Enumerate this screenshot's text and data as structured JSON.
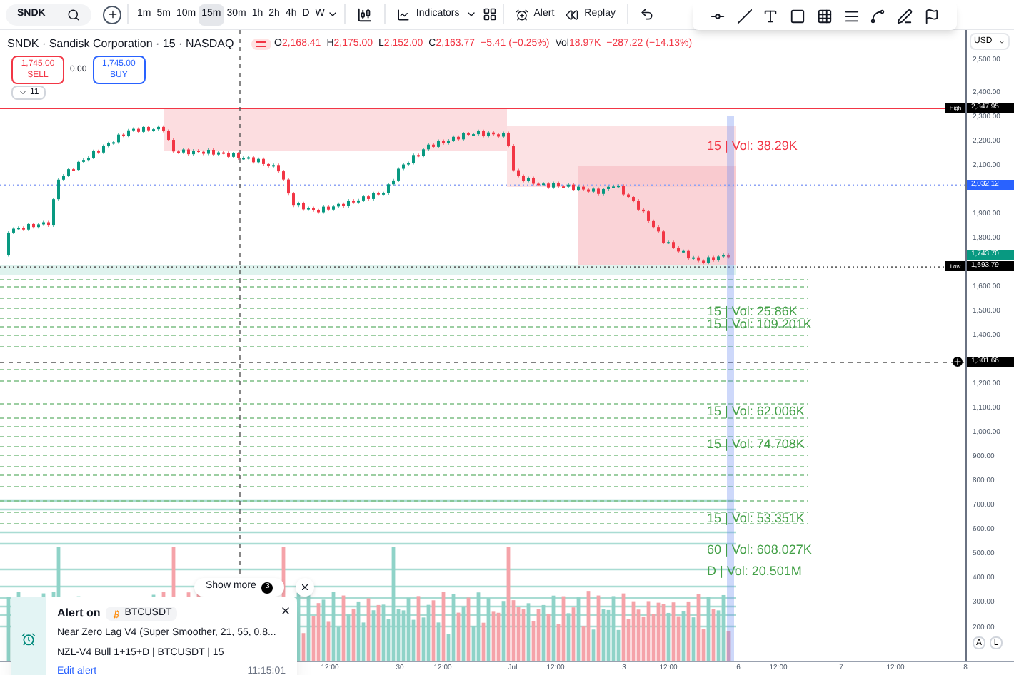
{
  "toolbar": {
    "symbol": "SNDK",
    "intervals": [
      {
        "label": "1m",
        "selected": false
      },
      {
        "label": "5m",
        "selected": false
      },
      {
        "label": "10m",
        "selected": false
      },
      {
        "label": "15m",
        "selected": true
      },
      {
        "label": "30m",
        "selected": false
      },
      {
        "label": "1h",
        "selected": false
      },
      {
        "label": "2h",
        "selected": false
      },
      {
        "label": "4h",
        "selected": false
      },
      {
        "label": "D",
        "selected": false
      },
      {
        "label": "W",
        "selected": false
      }
    ],
    "indicators_label": "Indicators",
    "alert_label": "Alert",
    "replay_label": "Replay"
  },
  "legend": {
    "toggle_on": true,
    "title": "SNDK · Sandisk Corporation · 15 · NASDAQ",
    "ohlc": [
      {
        "prefix": "O",
        "value": "2,168.41"
      },
      {
        "prefix": "H",
        "value": "2,175.00"
      },
      {
        "prefix": "L",
        "value": "2,152.00"
      },
      {
        "prefix": "C",
        "value": "2,163.77"
      }
    ],
    "change": "−5.41 (−0.25%)",
    "vol_label": "Vol",
    "vol_value": "18.97K",
    "session_change": "−287.22 (−14.13%)"
  },
  "trade": {
    "sell": {
      "price": "1,745.00",
      "label": "SELL"
    },
    "spread": "0.00",
    "buy": {
      "price": "1,745.00",
      "label": "BUY"
    }
  },
  "collapse_count": "11",
  "volume_labels": [
    {
      "text": "15 | Vol: 38.29K",
      "color": "#f23645"
    },
    {
      "text": "15 | Vol: 25.86K",
      "color": "#43a047"
    },
    {
      "text": "15 | Vol: 109.201K",
      "color": "#43a047"
    },
    {
      "text": "15 | Vol: 62.006K",
      "color": "#43a047"
    },
    {
      "text": "15 | Vol: 74.708K",
      "color": "#43a047"
    },
    {
      "text": "15 | Vol: 53.351K",
      "color": "#43a047"
    },
    {
      "text": "60 | Vol: 608.027K",
      "color": "#43a047"
    },
    {
      "text": "D | Vol: 20.501M",
      "color": "#43a047"
    }
  ],
  "price_axis": {
    "currency": "USD",
    "ticks": [
      "2,500.00",
      "2,400.00",
      "2,300.00",
      "2,200.00",
      "2,100.00",
      "1,900.00",
      "1,800.00",
      "1,600.00",
      "1,500.00",
      "1,400.00",
      "1,200.00",
      "1,100.00",
      "1,000.00",
      "900.00",
      "800.00",
      "700.00",
      "600.00",
      "500.00",
      "400.00",
      "300.00",
      "200.00"
    ],
    "badges": [
      {
        "kind": "high",
        "label": "High",
        "value": "2,347.95"
      },
      {
        "kind": "last",
        "value": "2,032.12"
      },
      {
        "kind": "current",
        "value": "1,743.70"
      },
      {
        "kind": "low",
        "label": "Low",
        "value": "1,693.79"
      },
      {
        "kind": "crosshair",
        "value": "1,301.66"
      }
    ],
    "scale_buttons": [
      "A",
      "L"
    ]
  },
  "time_axis": [
    "12:00",
    "30",
    "12:00",
    "Jul",
    "12:00",
    "3",
    "12:00",
    "6",
    "12:00",
    "7",
    "12:00",
    "8"
  ],
  "show_more": {
    "label": "Show more",
    "count": "3"
  },
  "alert": {
    "title": "Alert on",
    "symbol": "BTCUSDT",
    "lines": [
      "Near Zero Lag V4 (Super Smoother, 21, 55, 0.8...",
      "NZL-V4 Bull 1+15+D | BTCUSDT | 15"
    ],
    "link": "Edit alert",
    "time": "11:15:01"
  }
}
